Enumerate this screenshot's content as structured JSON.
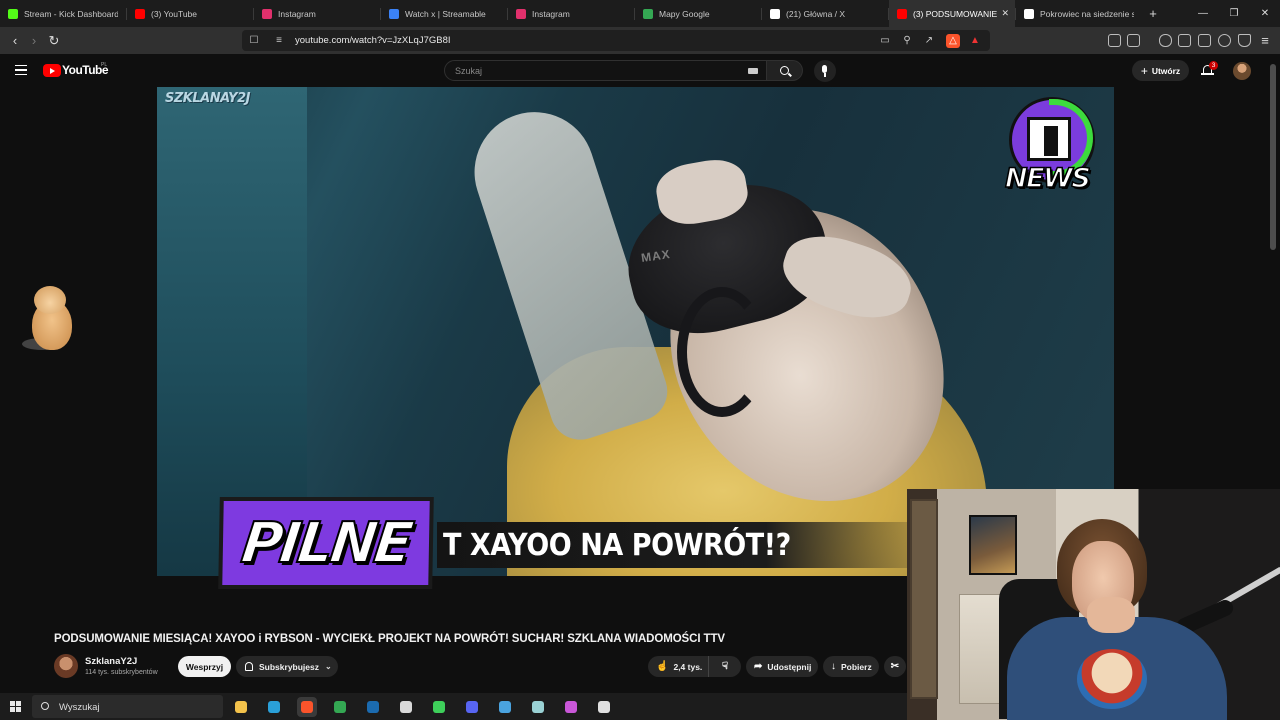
{
  "browser": {
    "tabs": [
      {
        "label": "Stream - Kick Dashboard",
        "icon": "kick-icon",
        "color": "#53fc18",
        "active": false
      },
      {
        "label": "(3) YouTube",
        "icon": "youtube-icon",
        "color": "#ff0000",
        "active": false
      },
      {
        "label": "Instagram",
        "icon": "instagram-icon",
        "color": "#e1306c",
        "active": false
      },
      {
        "label": "Watch x | Streamable",
        "icon": "streamable-icon",
        "color": "#3b82f6",
        "active": false
      },
      {
        "label": "Instagram",
        "icon": "instagram-icon",
        "color": "#e1306c",
        "active": false
      },
      {
        "label": "Mapy Google",
        "icon": "maps-icon",
        "color": "#34a853",
        "active": false
      },
      {
        "label": "(21) Główna / X",
        "icon": "x-icon",
        "color": "#ffffff",
        "active": false
      },
      {
        "label": "(3) PODSUMOWANIE",
        "icon": "youtube-icon",
        "color": "#ff0000",
        "active": true
      },
      {
        "label": "Pokrowiec na siedzenie sk",
        "icon": "page-icon",
        "color": "#ffffff",
        "active": false
      }
    ],
    "new_tab": "+",
    "url": "youtube.com/watch?v=JzXLqJ7GB8I"
  },
  "youtube": {
    "logo_text": "YouTube",
    "region": "PL",
    "search_placeholder": "Szukaj",
    "create_label": "Utwórz",
    "notifications_count": "3"
  },
  "video": {
    "watermark": "SZKLANAY2J",
    "brand_badge": "NEWS",
    "pilne": "PILNE",
    "headline": "T XAYOO NA POWRÓT!?",
    "title": "PODSUMOWANIE MIESIĄCA! XAYOO i RYBSON - WYCIEKŁ PROJEKT NA POWRÓT! SUCHAR! SZKLANA WIADOMOŚCI TTV",
    "channel_name": "SzklanaY2J",
    "subscribers": "114 tys. subskrybentów",
    "support_label": "Wesprzyj",
    "subscribe_label": "Subskrybujesz",
    "likes": "2,4 tys.",
    "share_label": "Udostępnij",
    "download_label": "Pobierz"
  },
  "taskbar": {
    "search_placeholder": "Wyszukaj",
    "apps": [
      {
        "icon": "file-explorer-icon",
        "color": "#f3c24b"
      },
      {
        "icon": "edge-icon",
        "color": "#2aa0d8"
      },
      {
        "icon": "brave-icon",
        "color": "#fb542b",
        "active": true
      },
      {
        "icon": "chrome-icon",
        "color": "#34a853"
      },
      {
        "icon": "steam-icon",
        "color": "#1b6bb0"
      },
      {
        "icon": "obs-icon",
        "color": "#d9d9d9"
      },
      {
        "icon": "game-launcher-icon",
        "color": "#3ecf5a"
      },
      {
        "icon": "discord-icon",
        "color": "#5865f2"
      },
      {
        "icon": "app-icon",
        "color": "#4aa3df"
      },
      {
        "icon": "notes-icon",
        "color": "#9ad1d4"
      },
      {
        "icon": "utility-icon",
        "color": "#c957d8"
      },
      {
        "icon": "window-icon",
        "color": "#e0e0e0"
      }
    ]
  }
}
